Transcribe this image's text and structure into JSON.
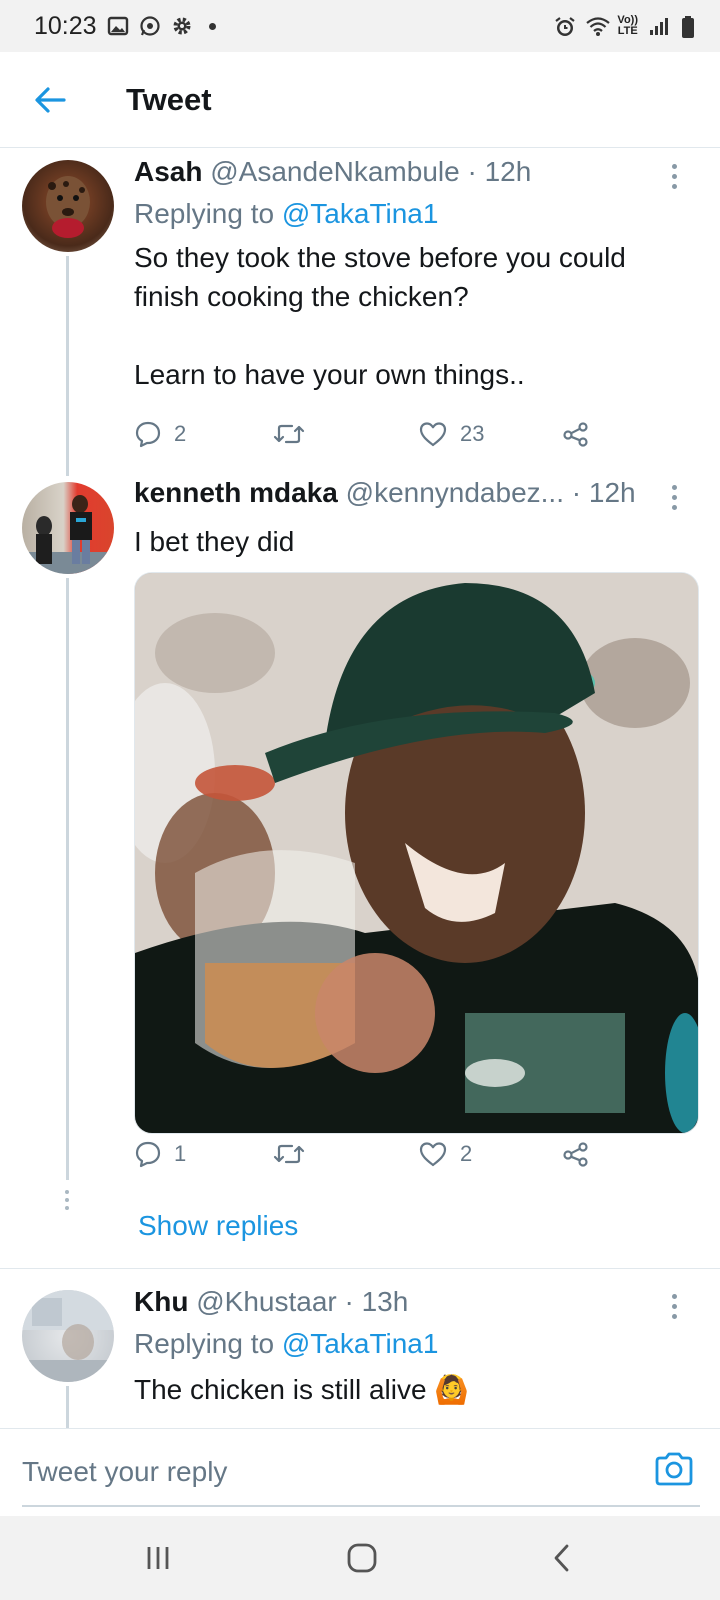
{
  "status_bar": {
    "time": "10:23",
    "lte_top": "Vo))",
    "lte_bottom": "LTE"
  },
  "header": {
    "title": "Tweet"
  },
  "tweets": [
    {
      "name": "Asah",
      "handle": "@AsandeNkambule",
      "sep": "·",
      "time": "12h",
      "replying_prefix": "Replying to",
      "replying_to": "@TakaTina1",
      "text_line1": "So they took the stove before you could",
      "text_line2": "finish cooking the chicken?",
      "text_line3": "Learn to have your own things..",
      "reply_count": "2",
      "retweet_count": "",
      "like_count": "23"
    },
    {
      "name": "kenneth mdaka",
      "handle": "@kennyndabez...",
      "sep": "·",
      "time": "12h",
      "text": "I bet they did",
      "reply_count": "1",
      "retweet_count": "",
      "like_count": "2",
      "show_replies": "Show replies"
    },
    {
      "name": "Khu",
      "handle": "@Khustaar",
      "sep": "·",
      "time": "13h",
      "replying_prefix": "Replying to",
      "replying_to": "@TakaTina1",
      "text": "The chicken is still alive",
      "emoji": "🙆"
    }
  ],
  "reply_bar": {
    "placeholder": "Tweet your reply"
  },
  "colors": {
    "accent": "#1b95e0",
    "muted": "#657786",
    "divider": "#e1e8ed"
  }
}
